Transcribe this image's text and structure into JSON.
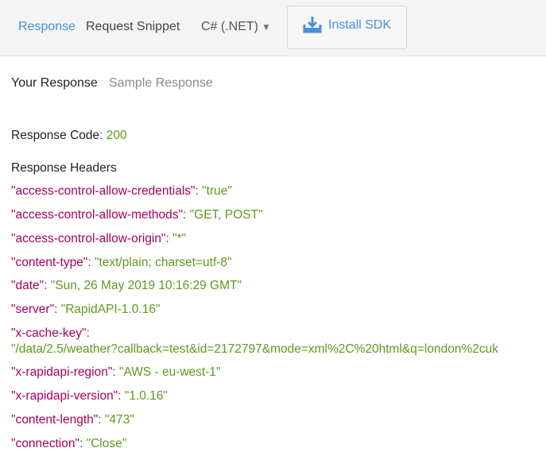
{
  "toolbar": {
    "response_tab": "Response",
    "request_snippet_tab": "Request Snippet",
    "language": "C# (.NET)",
    "install_sdk": "Install SDK"
  },
  "subtabs": {
    "your_response": "Your Response",
    "sample_response": "Sample Response"
  },
  "response": {
    "code_label": "Response Code",
    "code": "200",
    "headers_label": "Response Headers",
    "headers": [
      {
        "key": "\"access-control-allow-credentials\"",
        "value": "\"true\""
      },
      {
        "key": "\"access-control-allow-methods\"",
        "value": "\"GET, POST\""
      },
      {
        "key": "\"access-control-allow-origin\"",
        "value": "\"*\""
      },
      {
        "key": "\"content-type\"",
        "value": "\"text/plain; charset=utf-8\""
      },
      {
        "key": "\"date\"",
        "value": "\"Sun, 26 May 2019 10:16:29 GMT\""
      },
      {
        "key": "\"server\"",
        "value": "\"RapidAPI-1.0.16\""
      },
      {
        "key": "\"x-cache-key\"",
        "value": "\"/data/2.5/weather?callback=test&id=2172797&mode=xml%2C%20html&q=london%2cuk"
      },
      {
        "key": "\"x-rapidapi-region\"",
        "value": "\"AWS - eu-west-1\""
      },
      {
        "key": "\"x-rapidapi-version\"",
        "value": "\"1.0.16\""
      },
      {
        "key": "\"content-length\"",
        "value": "\"473\""
      },
      {
        "key": "\"connection\"",
        "value": "\"Close\""
      }
    ]
  },
  "colors": {
    "accent": "#4a8fd8",
    "header_key": "#a6005e",
    "header_value": "#5d9a1d"
  }
}
